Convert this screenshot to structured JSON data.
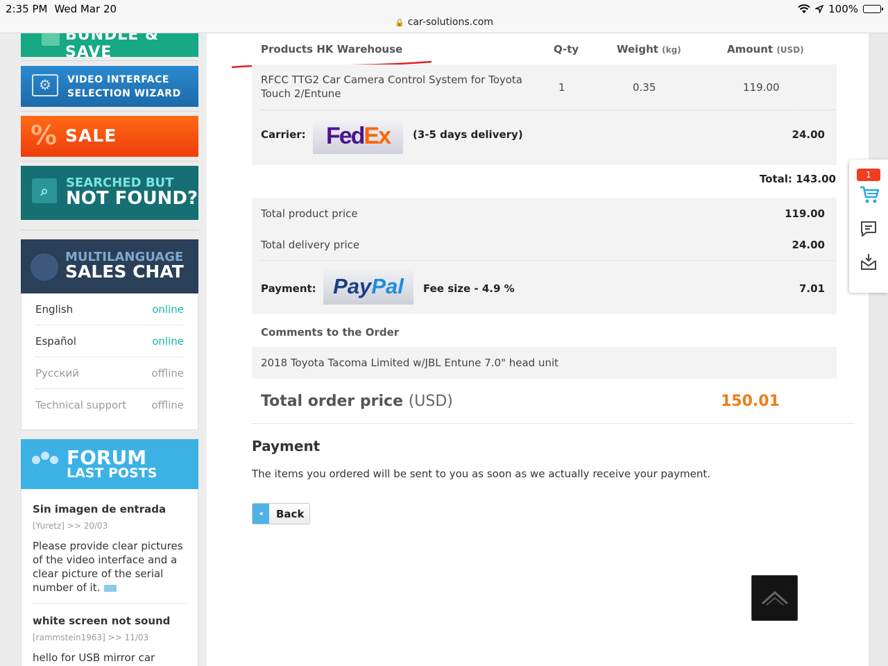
{
  "status_bar": {
    "time": "2:35 PM",
    "date": "Wed Mar 20",
    "url": "car-solutions.com",
    "battery": "100%"
  },
  "sidebar": {
    "banners": {
      "bundle": "BUNDLE & SAVE",
      "video_line1": "VIDEO INTERFACE",
      "video_line2": "SELECTION WIZARD",
      "sale_symbol": "%",
      "sale": "SALE",
      "searched_line1": "SEARCHED BUT",
      "searched_line2": "NOT FOUND?",
      "chat_line1": "MULTILANGUAGE",
      "chat_line2": "SALES CHAT",
      "forum_line1": "FORUM",
      "forum_line2": "LAST POSTS"
    },
    "chat_languages": [
      {
        "language": "English",
        "status": "online"
      },
      {
        "language": "Español",
        "status": "online"
      },
      {
        "language": "Русский",
        "status": "offline"
      },
      {
        "language": "Technical support",
        "status": "offline"
      }
    ],
    "forum_posts": [
      {
        "title": "Sin imagen de entrada",
        "meta": "[Yuretz] >> 20/03",
        "body": "Please provide clear pictures of the video interface and a clear picture of the serial number of it."
      },
      {
        "title": "white screen not sound",
        "meta": "[rammstein1963] >> 11/03",
        "body": "hello for USB mirror car"
      }
    ]
  },
  "order": {
    "headers": {
      "product": "Products HK Warehouse",
      "qty": "Q-ty",
      "weight": "Weight",
      "weight_unit": "(kg)",
      "amount": "Amount",
      "amount_unit": "(USD)"
    },
    "item": {
      "name": "RFCC TTG2 Car Camera Control System for Toyota Touch 2/Entune",
      "qty": "1",
      "weight": "0.35",
      "amount": "119.00"
    },
    "carrier": {
      "label": "Carrier:",
      "logo_part1": "Fed",
      "logo_part2": "Ex",
      "delivery": "(3-5 days delivery)",
      "cost": "24.00"
    },
    "total_line": "Total: 143.00",
    "summary": {
      "product_label": "Total product price",
      "product_value": "119.00",
      "delivery_label": "Total delivery price",
      "delivery_value": "24.00",
      "payment_label": "Payment:",
      "paypal_part1": "Pay",
      "paypal_part2": "Pal",
      "fee_text": "Fee size - 4.9 %",
      "fee_value": "7.01"
    },
    "comments_heading": "Comments to the Order",
    "comment": "2018 Toyota Tacoma Limited w/JBL Entune 7.0\" head unit",
    "grand_total_label": "Total order price",
    "grand_total_unit": "(USD)",
    "grand_total_value": "150.01"
  },
  "payment_section": {
    "heading": "Payment",
    "text": "The items you ordered will be sent to you as soon as we actually receive your payment.",
    "back_button": "Back"
  },
  "side_tools": {
    "cart_count": "1"
  },
  "colors": {
    "accent_orange": "#f07d17",
    "online": "#17b4b0",
    "badge_red": "#ef3d21"
  }
}
